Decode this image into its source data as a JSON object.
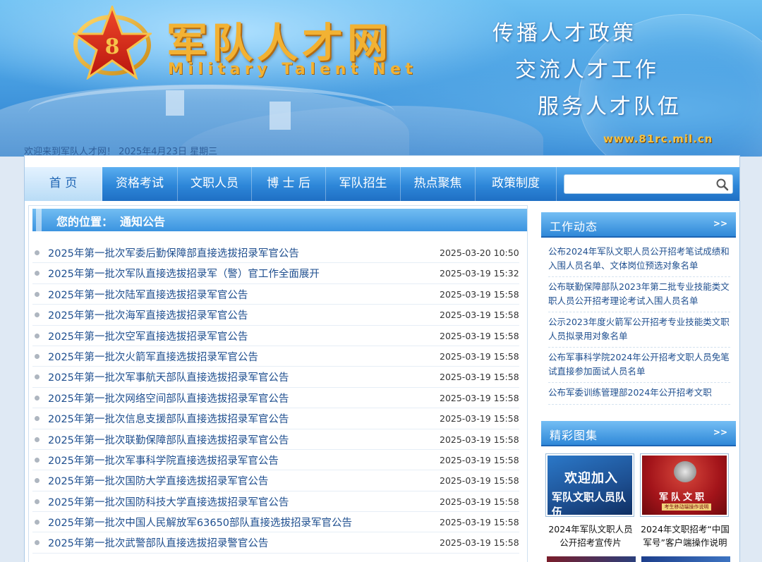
{
  "header": {
    "site_title": "军队人才网",
    "site_subtitle": "Military Talent Net",
    "slogans": [
      "传播人才政策",
      "交流人才工作",
      "服务人才队伍"
    ],
    "site_url": "www.81rc.mil.cn",
    "welcome": "欢迎来到军队人才网！ 2025年4月23日 星期三"
  },
  "nav": {
    "items": [
      {
        "label": "首 页"
      },
      {
        "label": "资格考试"
      },
      {
        "label": "文职人员"
      },
      {
        "label": "博 士 后"
      },
      {
        "label": "军队招生"
      },
      {
        "label": "热点聚焦"
      },
      {
        "label": "政策制度"
      }
    ],
    "search_placeholder": ""
  },
  "breadcrumb": {
    "prefix": "您的位置：",
    "current": "通知公告"
  },
  "notices": [
    {
      "title": "2025年第一批次军委后勤保障部直接选拔招录军官公告",
      "date": "2025-03-20 10:50"
    },
    {
      "title": "2025年第一批次军队直接选拔招录军（警）官工作全面展开",
      "date": "2025-03-19 15:32"
    },
    {
      "title": "2025年第一批次陆军直接选拔招录军官公告",
      "date": "2025-03-19 15:58"
    },
    {
      "title": "2025年第一批次海军直接选拔招录军官公告",
      "date": "2025-03-19 15:58"
    },
    {
      "title": "2025年第一批次空军直接选拔招录军官公告",
      "date": "2025-03-19 15:58"
    },
    {
      "title": "2025年第一批次火箭军直接选拔招录军官公告",
      "date": "2025-03-19 15:58"
    },
    {
      "title": "2025年第一批次军事航天部队直接选拔招录军官公告",
      "date": "2025-03-19 15:58"
    },
    {
      "title": "2025年第一批次网络空间部队直接选拔招录军官公告",
      "date": "2025-03-19 15:58"
    },
    {
      "title": "2025年第一批次信息支援部队直接选拔招录军官公告",
      "date": "2025-03-19 15:58"
    },
    {
      "title": "2025年第一批次联勤保障部队直接选拔招录军官公告",
      "date": "2025-03-19 15:58"
    },
    {
      "title": "2025年第一批次军事科学院直接选拔招录军官公告",
      "date": "2025-03-19 15:58"
    },
    {
      "title": "2025年第一批次国防大学直接选拔招录军官公告",
      "date": "2025-03-19 15:58"
    },
    {
      "title": "2025年第一批次国防科技大学直接选拔招录军官公告",
      "date": "2025-03-19 15:58"
    },
    {
      "title": "2025年第一批次中国人民解放军63650部队直接选拔招录军官公告",
      "date": "2025-03-19 15:58"
    },
    {
      "title": "2025年第一批次武警部队直接选拔招录警官公告",
      "date": "2025-03-19 15:58"
    }
  ],
  "work_news": {
    "heading": "工作动态",
    "more": ">>",
    "items": [
      "公布2024年军队文职人员公开招考笔试成绩和入围人员名单、文体岗位预选对象名单",
      "公布联勤保障部队2023年第二批专业技能类文职人员公开招考理论考试入围人员名单",
      "公示2023年度火箭军公开招考专业技能类文职人员拟录用对象名单",
      "公布军事科学院2024年公开招考文职人员免笔试直接参加面试人员名单",
      "公布军委训练管理部2024年公开招考文职"
    ]
  },
  "gallery": {
    "heading": "精彩图集",
    "more": ">>",
    "items": [
      {
        "caption": "2024年军队文职人员公开招考宣传片",
        "art_line1": "欢迎加入",
        "art_line2": "军队文职人员队伍"
      },
      {
        "caption": "2024年文职招考“中国军号”客户端操作说明",
        "art_line1": "军队文职",
        "art_line2": "考生移动端操作说明"
      }
    ]
  },
  "colors": {
    "nav_blue": "#2d86d8",
    "link_blue": "#1f4f8f",
    "title_gold": "#f2b233",
    "url_gold": "#f5c242"
  }
}
